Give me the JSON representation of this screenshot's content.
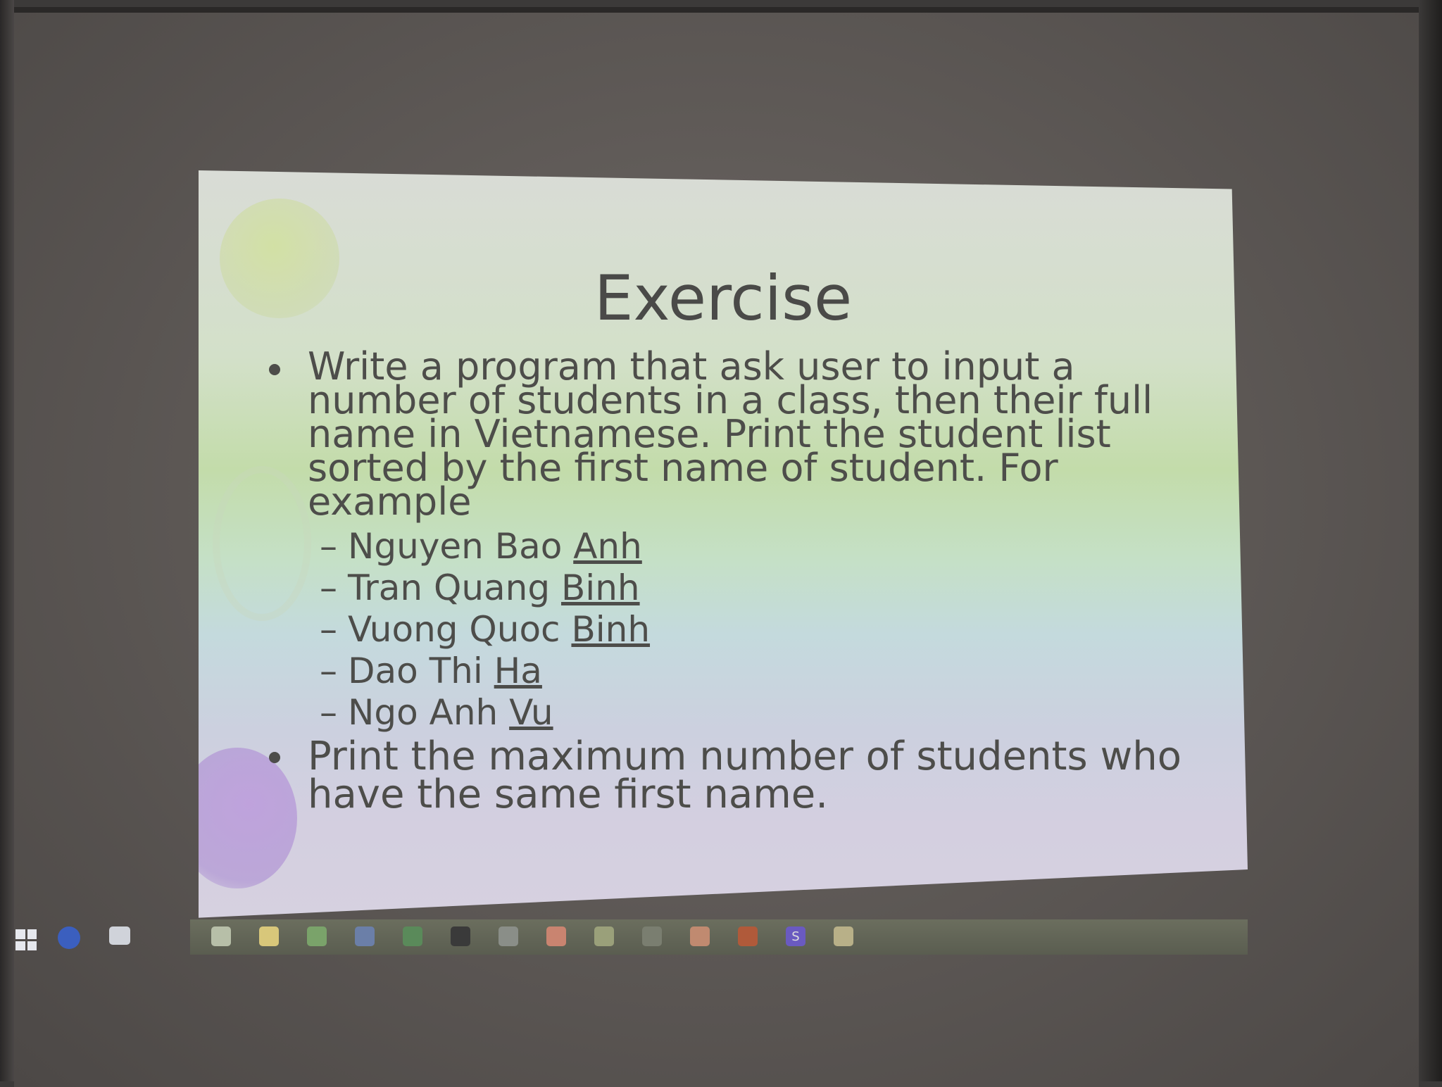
{
  "slide": {
    "title": "Exercise",
    "bullets": [
      "Write a program that ask user to input a number of students in a class, then their full name in Vietnamese. Print the student list sorted by the first name of student. For example",
      "Print the maximum number of students who have the same first name."
    ],
    "examples": [
      {
        "dash": "–",
        "rest": "Nguyen Bao",
        "first_name": "Anh"
      },
      {
        "dash": "–",
        "rest": "Tran Quang",
        "first_name": "Binh"
      },
      {
        "dash": "–",
        "rest": "Vuong Quoc",
        "first_name": "Binh"
      },
      {
        "dash": "–",
        "rest": "Dao Thi",
        "first_name": "Ha"
      },
      {
        "dash": "–",
        "rest": "Ngo Anh",
        "first_name": "Vu"
      }
    ]
  },
  "taskbar": {
    "icons": [
      {
        "name": "windows-start-icon"
      },
      {
        "name": "cortana-icon",
        "color": "#3b5fbf"
      },
      {
        "name": "task-view-icon"
      },
      {
        "name": "word-icon",
        "color": "#b7bfa8"
      },
      {
        "name": "file-explorer-icon",
        "color": "#d8c77a"
      },
      {
        "name": "app-icon-3",
        "color": "#7aa36a"
      },
      {
        "name": "app-icon-4",
        "color": "#6b7fa8"
      },
      {
        "name": "chrome-icon",
        "color": "#5a8a5a"
      },
      {
        "name": "app-icon-6",
        "color": "#3a3a3a"
      },
      {
        "name": "app-icon-7",
        "color": "#8a8e88"
      },
      {
        "name": "powerpoint-icon",
        "color": "#c98470"
      },
      {
        "name": "app-icon-9",
        "color": "#9aa07a"
      },
      {
        "name": "app-icon-10",
        "color": "#7a7e70"
      },
      {
        "name": "app-icon-11",
        "color": "#c08a70"
      },
      {
        "name": "app-icon-12",
        "color": "#b05a3a"
      },
      {
        "name": "skype-icon",
        "color": "#6a5ac0",
        "glyph": "S"
      },
      {
        "name": "app-icon-14",
        "color": "#b8b088"
      }
    ]
  }
}
